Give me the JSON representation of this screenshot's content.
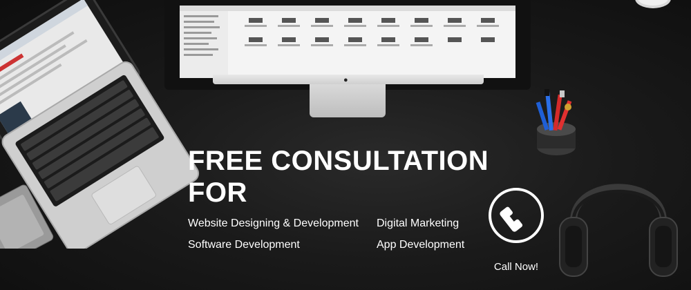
{
  "banner": {
    "headline_line1": "FREE CONSULTATION",
    "headline_line2": "FOR",
    "services": [
      "Website Designing & Development",
      "Software Development",
      "Digital Marketing",
      "App Development"
    ],
    "call_label": "Call Now!"
  },
  "icons": {
    "phone": "phone-icon",
    "apple_logo": "apple-logo"
  },
  "colors": {
    "background": "#141414",
    "text": "#ffffff"
  }
}
